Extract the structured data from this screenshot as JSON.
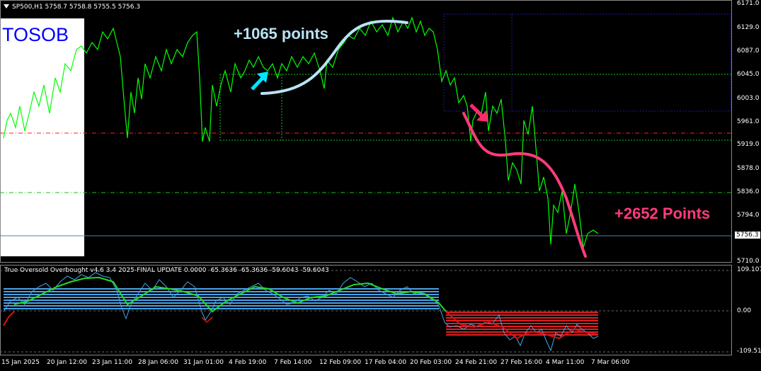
{
  "header": {
    "symbol_line": "SP500,H1  5758.7 5758.8 5755.5 5756.3",
    "indicator_line": "True Oversold Overbought v4.6 3.4 2025-FINAL UPDATE 0.0000 -65.3636 -65.3636 -59.6043 -59.6043"
  },
  "brand": {
    "label": "TOSOB"
  },
  "annotations": {
    "gain_up": "+1065 points",
    "gain_down": "+2652 Points"
  },
  "price_axis": [
    "6171.0",
    "6129.0",
    "6087.0",
    "6045.0",
    "6003.0",
    "5961.0",
    "5919.0",
    "5878.0",
    "5836.0",
    "5794.0",
    "5756.3",
    "5710.0"
  ],
  "indicator_axis": {
    "top": "109.1071",
    "mid": "0.00",
    "bottom": "-109.5167"
  },
  "time_axis": [
    "15 Jan 2025",
    "20 Jan 12:00",
    "23 Jan 11:00",
    "28 Jan 06:00",
    "31 Jan 01:00",
    "4 Feb 19:00",
    "7 Feb 14:00",
    "12 Feb 09:00",
    "17 Feb 04:00",
    "20 Feb 03:00",
    "24 Feb 21:00",
    "27 Feb 16:00",
    "4 Mar 11:00",
    "7 Mar 06:00"
  ],
  "colors": {
    "price_line": "#00ff00",
    "up_arrow": "#00e5ff",
    "down_arrow": "#ff2a6d",
    "curve_up": "#b8e3f5",
    "curve_down": "#ff3b7a",
    "red_level": "#ff2020",
    "green_level": "#19c219",
    "blue_box": "#1a1aa8",
    "hist_pos": "#4aa3e8",
    "hist_neg": "#e02020",
    "osc_green": "#22dd22",
    "osc_red": "#dd1111"
  }
}
